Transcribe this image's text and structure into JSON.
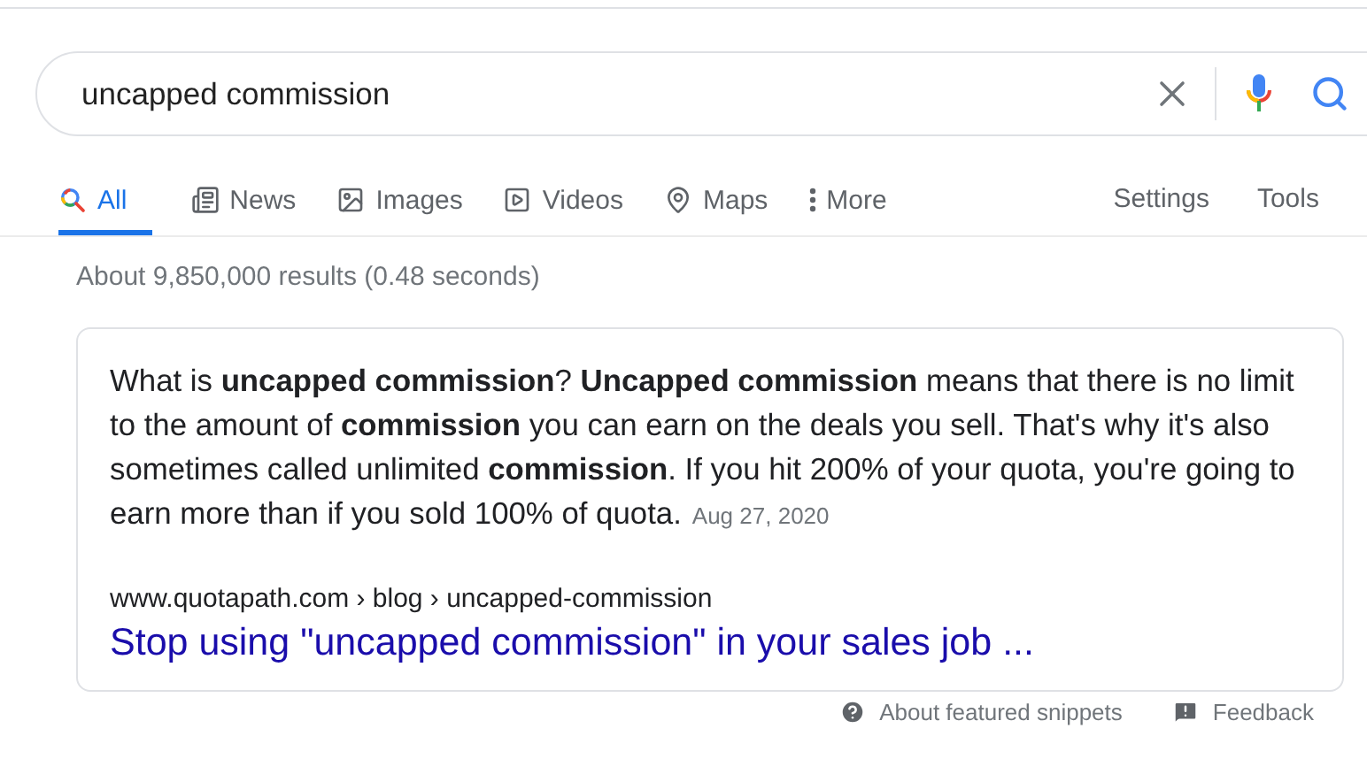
{
  "search": {
    "value": "uncapped commission"
  },
  "tabs": [
    {
      "label": "All",
      "selected": true
    },
    {
      "label": "News",
      "selected": false
    },
    {
      "label": "Images",
      "selected": false
    },
    {
      "label": "Videos",
      "selected": false
    },
    {
      "label": "Maps",
      "selected": false
    },
    {
      "label": "More",
      "selected": false
    }
  ],
  "tools": [
    "Settings",
    "Tools"
  ],
  "result_stats": "About 9,850,000 results (0.48 seconds)",
  "snippet": {
    "text": "What is **uncapped commission**? **Uncapped commission** means that there is no limit to the amount of **commission** you can earn on the deals you sell. That's why it's also sometimes called unlimited **commission**. If you hit 200% of your quota, you're going to earn more than if you sold 100% of quota.",
    "date": "Aug 27, 2020",
    "breadcrumb": "www.quotapath.com › blog › uncapped-commission",
    "link": "Stop using \"uncapped commission\" in your sales job ..."
  },
  "footer": [
    {
      "label": "About featured snippets"
    },
    {
      "label": "Feedback"
    }
  ]
}
